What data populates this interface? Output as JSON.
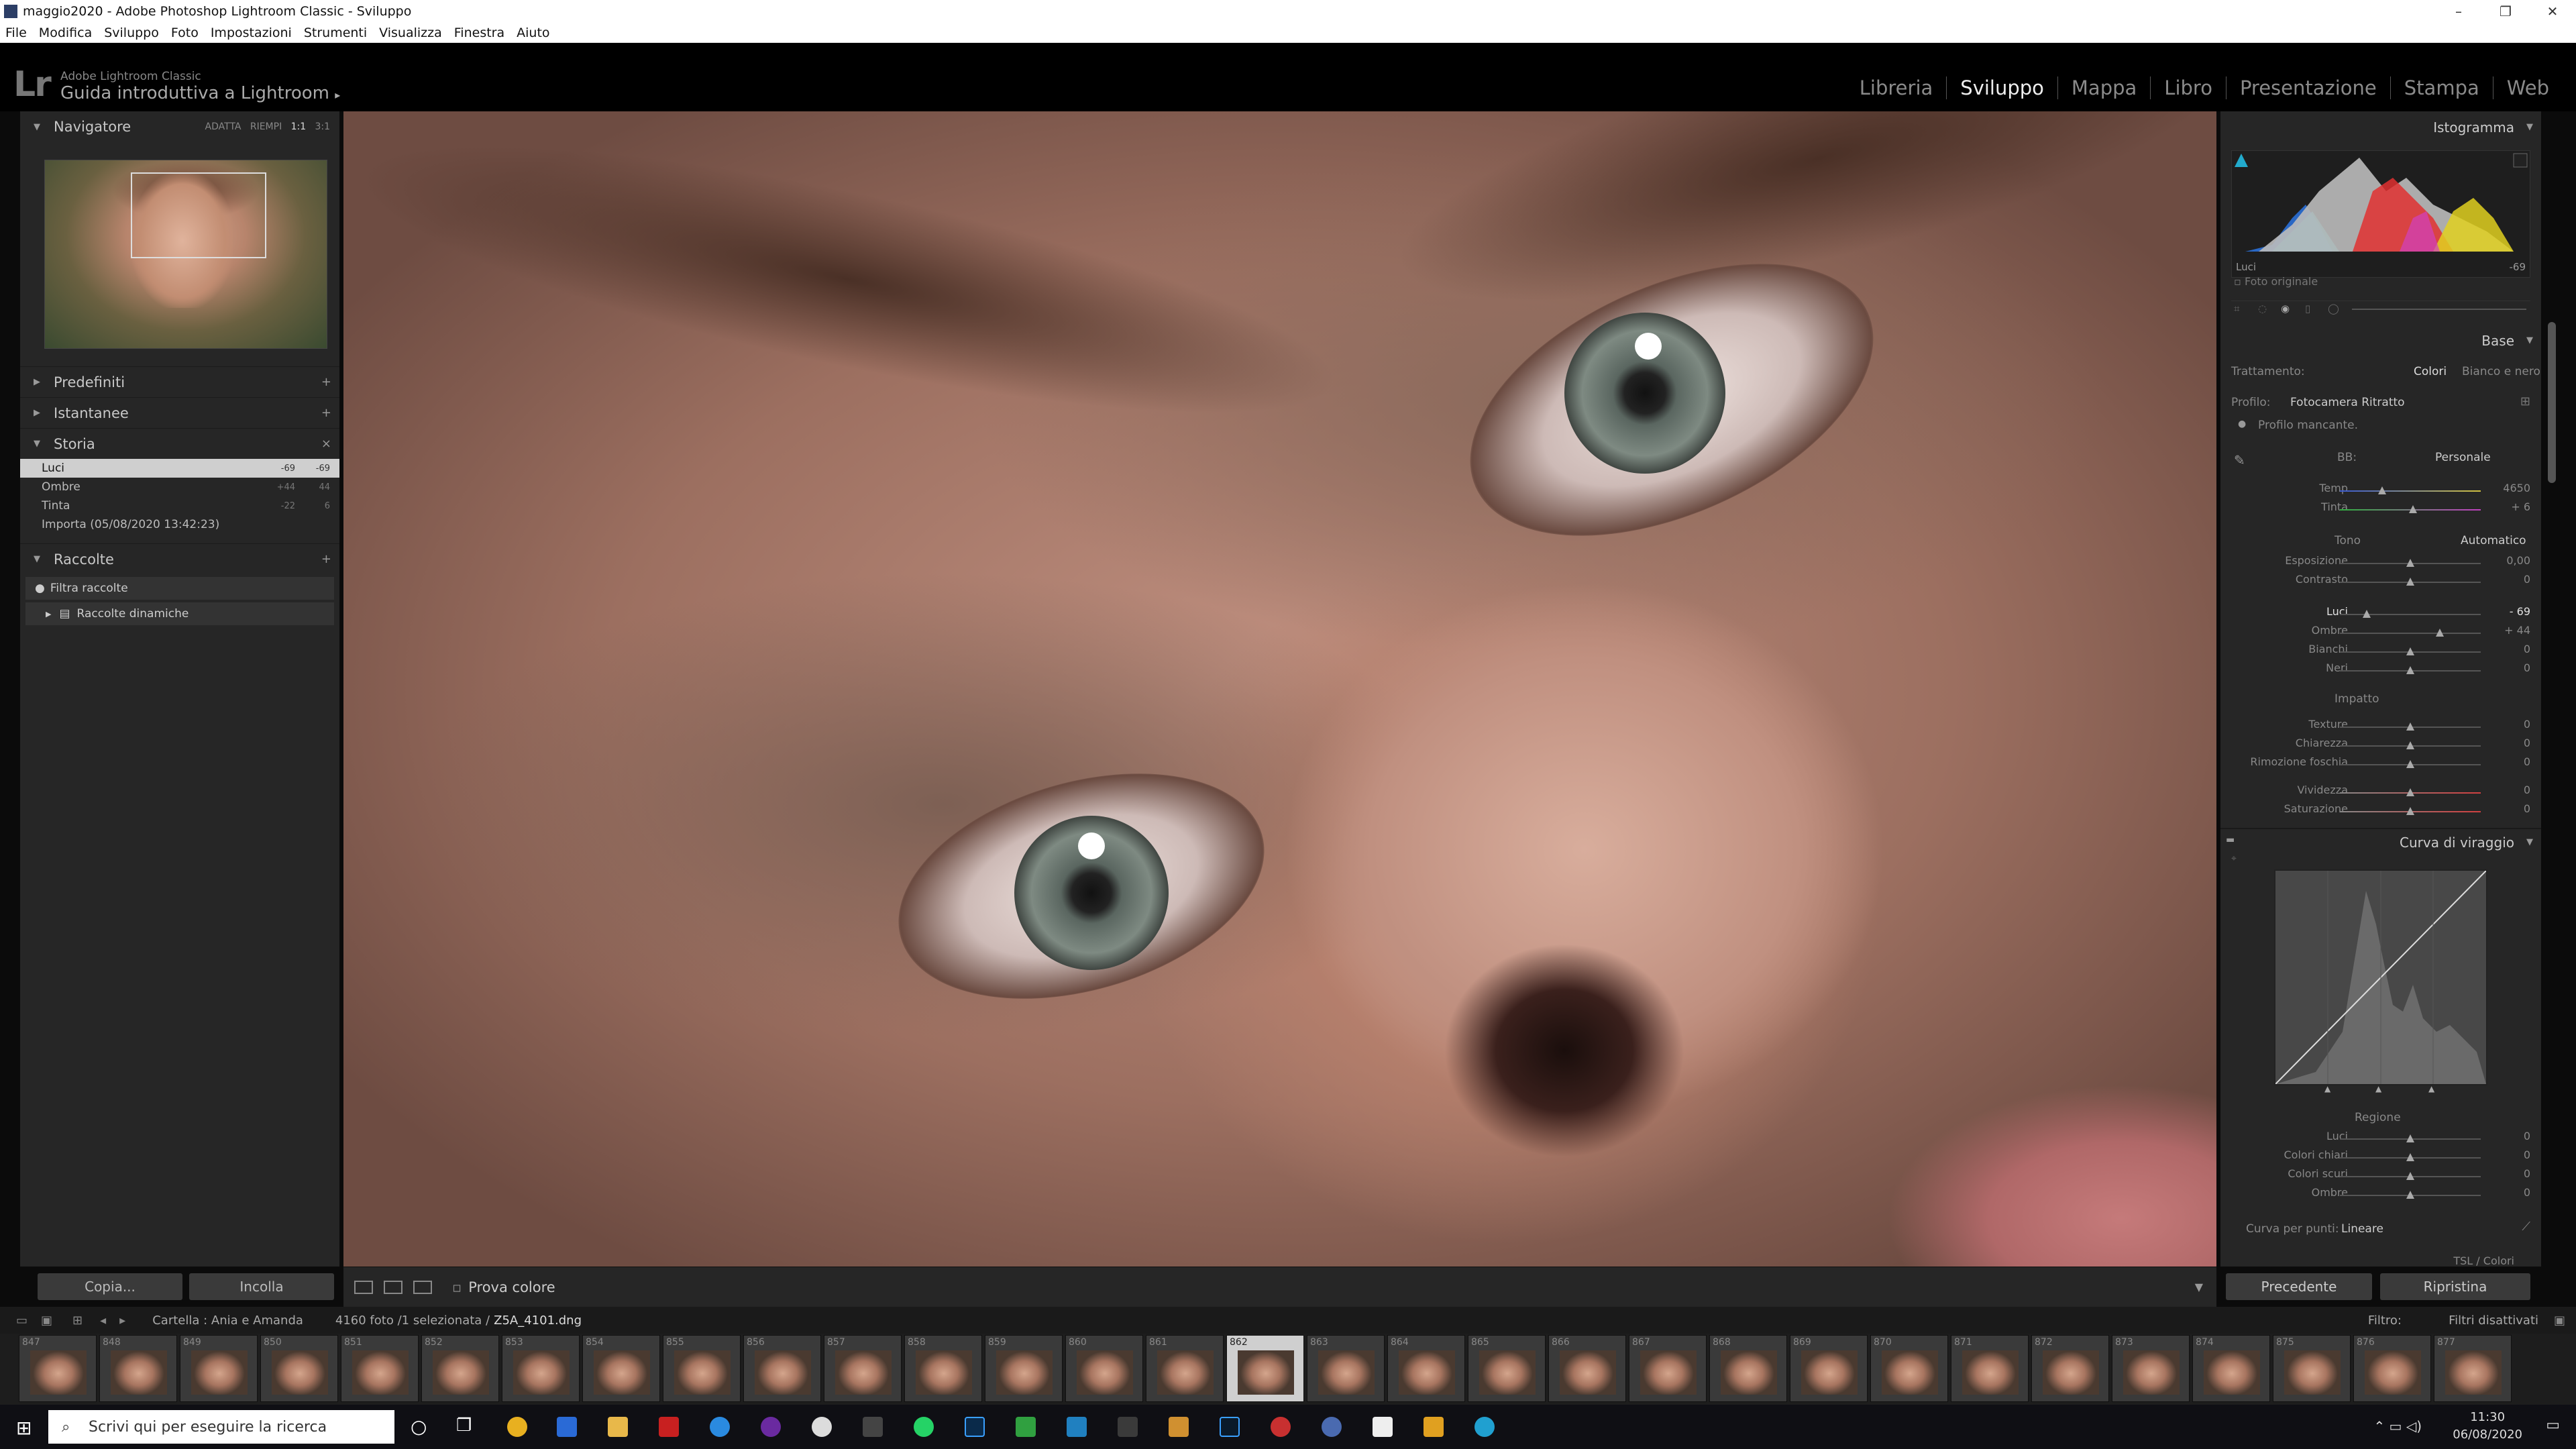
{
  "window": {
    "title": "maggio2020 - Adobe Photoshop Lightroom Classic - Sviluppo"
  },
  "menu": [
    "File",
    "Modifica",
    "Sviluppo",
    "Foto",
    "Impostazioni",
    "Strumenti",
    "Visualizza",
    "Finestra",
    "Aiuto"
  ],
  "identity": {
    "logo": "Lr",
    "app_name": "Adobe Lightroom Classic",
    "subtitle": "Guida introduttiva a Lightroom",
    "subtitle_arrow": "▸"
  },
  "modules": [
    "Libreria",
    "Sviluppo",
    "Mappa",
    "Libro",
    "Presentazione",
    "Stampa",
    "Web"
  ],
  "active_module": "Sviluppo",
  "left_panel": {
    "navigator": {
      "title": "Navigatore",
      "zoom_options": [
        "ADATTA",
        "RIEMPI",
        "1:1",
        "3:1"
      ]
    },
    "presets": {
      "title": "Predefiniti"
    },
    "snapshots": {
      "title": "Istantanee"
    },
    "history": {
      "title": "Storia",
      "items": [
        {
          "label": "Luci",
          "v1": "-69",
          "v2": "-69"
        },
        {
          "label": "Ombre",
          "v1": "+44",
          "v2": "44"
        },
        {
          "label": "Tinta",
          "v1": "-22",
          "v2": "6"
        },
        {
          "label": "Importa (05/08/2020 13:42:23)",
          "v1": "",
          "v2": ""
        }
      ]
    },
    "collections": {
      "title": "Raccolte",
      "filter": "Filtra raccolte",
      "smart": "Raccolte dinamiche"
    },
    "copy_label": "Copia...",
    "paste_label": "Incolla"
  },
  "toolbar": {
    "label": "Prova colore"
  },
  "right_panel": {
    "histogram": {
      "title": "Istogramma",
      "readout_label": "Luci",
      "readout_value": "-69",
      "original_label": "Foto originale"
    },
    "basic": {
      "title": "Base",
      "treatment_label": "Trattamento:",
      "treatment_color": "Colori",
      "treatment_bw": "Bianco e nero",
      "profile_label": "Profilo:",
      "profile_value": "Fotocamera Ritratto",
      "profile_missing": "Profilo mancante.",
      "wb_label": "BB:",
      "wb_value": "Personale",
      "tone_label": "Tono",
      "auto_label": "Automatico",
      "impact_label": "Impatto",
      "sliders": [
        {
          "label": "Temp",
          "value": "4650",
          "pos": 0.3
        },
        {
          "label": "Tinta",
          "value": "+ 6",
          "pos": 0.52
        },
        {
          "label": "Esposizione",
          "value": "0,00",
          "pos": 0.5
        },
        {
          "label": "Contrasto",
          "value": "0",
          "pos": 0.5
        },
        {
          "label": "Luci",
          "value": "- 69",
          "pos": 0.19
        },
        {
          "label": "Ombre",
          "value": "+ 44",
          "pos": 0.71
        },
        {
          "label": "Bianchi",
          "value": "0",
          "pos": 0.5
        },
        {
          "label": "Neri",
          "value": "0",
          "pos": 0.5
        },
        {
          "label": "Texture",
          "value": "0",
          "pos": 0.5
        },
        {
          "label": "Chiarezza",
          "value": "0",
          "pos": 0.5
        },
        {
          "label": "Rimozione foschia",
          "value": "0",
          "pos": 0.5
        },
        {
          "label": "Vividezza",
          "value": "0",
          "pos": 0.5
        },
        {
          "label": "Saturazione",
          "value": "0",
          "pos": 0.5
        }
      ]
    },
    "tone_curve": {
      "title": "Curva di viraggio",
      "region_label": "Regione",
      "sliders": [
        {
          "label": "Luci",
          "value": "0",
          "pos": 0.5
        },
        {
          "label": "Colori chiari",
          "value": "0",
          "pos": 0.5
        },
        {
          "label": "Colori scuri",
          "value": "0",
          "pos": 0.5
        },
        {
          "label": "Ombre",
          "value": "0",
          "pos": 0.5
        }
      ],
      "point_curve_label": "Curva per punti:",
      "point_curve_value": "Lineare"
    },
    "next_section": "TSL / Colori",
    "prev_label": "Precedente",
    "reset_label": "Ripristina"
  },
  "filmstrip_bar": {
    "folder": "Cartella : Ania e Amanda",
    "count": "4160 foto /1 selezionata /",
    "file": "Z5A_4101.dng",
    "filter_label": "Filtro:",
    "filter_value": "Filtri disattivati"
  },
  "filmstrip": {
    "numbers": [
      "847",
      "848",
      "849",
      "850",
      "851",
      "852",
      "853",
      "854",
      "855",
      "856",
      "857",
      "858",
      "859",
      "860",
      "861",
      "862",
      "863",
      "864",
      "865",
      "866",
      "867",
      "868",
      "869",
      "870",
      "871",
      "872",
      "873",
      "874",
      "875",
      "876",
      "877"
    ],
    "selected": "862"
  },
  "taskbar": {
    "search_placeholder": "Scrivi qui per eseguire la ricerca",
    "time": "11:30",
    "date": "06/08/2020"
  },
  "colors": {
    "panel": "#262626",
    "accent_sel": "#cfcfcf",
    "bg": "#0b0b0b"
  }
}
